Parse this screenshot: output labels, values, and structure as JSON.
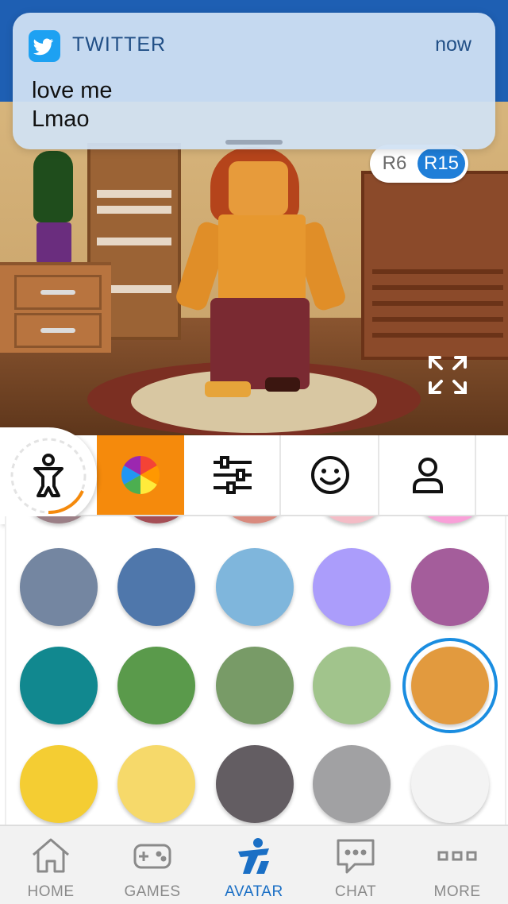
{
  "notification": {
    "app_name": "TWITTER",
    "time": "now",
    "message": "love me\nLmao"
  },
  "rig_toggle": {
    "options": [
      "R6",
      "R15"
    ],
    "selected": "R15"
  },
  "toolbar": {
    "tabs": [
      {
        "name": "body",
        "icon": "body-icon"
      },
      {
        "name": "skin-color",
        "icon": "color-wheel-icon",
        "active": true
      },
      {
        "name": "scale",
        "icon": "sliders-icon"
      },
      {
        "name": "face",
        "icon": "smiley-icon"
      },
      {
        "name": "profile",
        "icon": "person-icon"
      }
    ]
  },
  "colors": {
    "accent": "#f58a0c",
    "selection": "#1a8de0",
    "partial_row": [
      "#9b7f86",
      "#a54e55",
      "#d98a7e",
      "#f4bcc6",
      "#f9a0d8"
    ],
    "rows": [
      [
        "#7486a1",
        "#4f77ab",
        "#7fb6dc",
        "#ab9dfb",
        "#a45d9b"
      ],
      [
        "#11888f",
        "#5a9a4b",
        "#789b67",
        "#a1c48c",
        "#e29a3e"
      ],
      [
        "#f4cd33",
        "#f6d96a",
        "#635d62",
        "#a1a1a3",
        "#f3f3f3"
      ]
    ],
    "selected": "#e29a3e"
  },
  "nav": {
    "items": [
      {
        "label": "HOME",
        "icon": "home-icon"
      },
      {
        "label": "GAMES",
        "icon": "gamepad-icon"
      },
      {
        "label": "AVATAR",
        "icon": "avatar-icon",
        "active": true
      },
      {
        "label": "CHAT",
        "icon": "chat-icon"
      },
      {
        "label": "MORE",
        "icon": "more-icon"
      }
    ]
  }
}
